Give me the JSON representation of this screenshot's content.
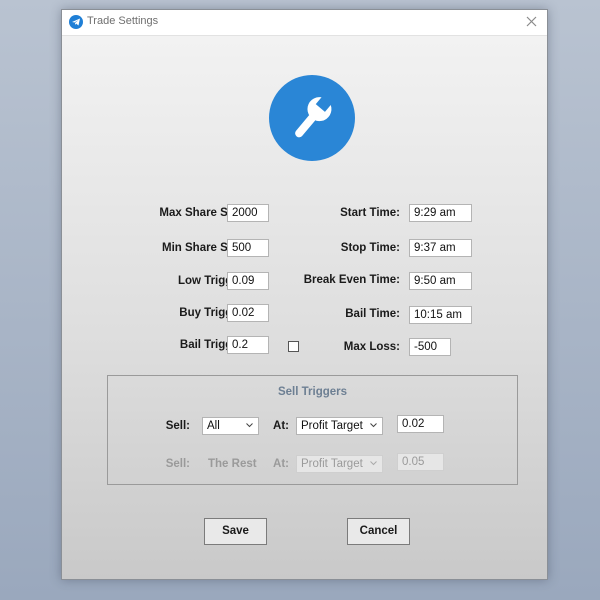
{
  "window": {
    "title": "Trade Settings",
    "icon": "telegram-plane-icon",
    "close_icon": "close-icon"
  },
  "logo": {
    "icon": "wrench-icon",
    "color": "#2a86d6"
  },
  "settings": {
    "max_share_size": {
      "label": "Max Share Size:",
      "value": "2000"
    },
    "min_share_size": {
      "label": "Min Share Size:",
      "value": "500"
    },
    "low_trigger": {
      "label": "Low Trigger:",
      "value": "0.09"
    },
    "buy_trigger": {
      "label": "Buy Trigger:",
      "value": "0.02"
    },
    "bail_trigger": {
      "label": "Bail Trigger:",
      "value": "0.2",
      "checkbox_checked": false
    },
    "start_time": {
      "label": "Start Time:",
      "value": "9:29 am"
    },
    "stop_time": {
      "label": "Stop Time:",
      "value": "9:37 am"
    },
    "break_even_time": {
      "label": "Break Even Time:",
      "value": "9:50 am"
    },
    "bail_time": {
      "label": "Bail Time:",
      "value": "10:15 am"
    },
    "max_loss": {
      "label": "Max Loss:",
      "value": "-500"
    }
  },
  "sell_triggers": {
    "title": "Sell Triggers",
    "row1": {
      "sell_label": "Sell:",
      "sell_value": "All",
      "at_label": "At:",
      "at_value": "Profit Target",
      "amount": "0.02"
    },
    "row2": {
      "sell_label": "Sell:",
      "sell_value": "The Rest",
      "at_label": "At:",
      "at_value": "Profit Target",
      "amount": "0.05",
      "disabled": true
    }
  },
  "buttons": {
    "save": "Save",
    "cancel": "Cancel"
  }
}
